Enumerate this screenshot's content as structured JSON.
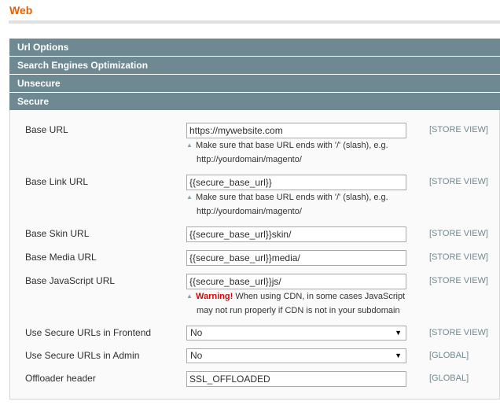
{
  "page": {
    "title": "Web"
  },
  "sections": [
    {
      "label": "Url Options"
    },
    {
      "label": "Search Engines Optimization"
    },
    {
      "label": "Unsecure"
    },
    {
      "label": "Secure"
    }
  ],
  "fields": {
    "base_url": {
      "label": "Base URL",
      "value": "https://mywebsite.com",
      "scope": "[STORE VIEW]",
      "note_line1": "Make sure that base URL ends with '/' (slash), e.g.",
      "note_line2": "http://yourdomain/magento/"
    },
    "base_link_url": {
      "label": "Base Link URL",
      "value": "{{secure_base_url}}",
      "scope": "[STORE VIEW]",
      "note_line1": "Make sure that base URL ends with '/' (slash), e.g.",
      "note_line2": "http://yourdomain/magento/"
    },
    "base_skin_url": {
      "label": "Base Skin URL",
      "value": "{{secure_base_url}}skin/",
      "scope": "[STORE VIEW]"
    },
    "base_media_url": {
      "label": "Base Media URL",
      "value": "{{secure_base_url}}media/",
      "scope": "[STORE VIEW]"
    },
    "base_js_url": {
      "label": "Base JavaScript URL",
      "value": "{{secure_base_url}}js/",
      "scope": "[STORE VIEW]",
      "warning_label": "Warning!",
      "note_line1": "When using CDN, in some cases JavaScript",
      "note_line2": "may not run properly if CDN is not in your subdomain"
    },
    "use_secure_frontend": {
      "label": "Use Secure URLs in Frontend",
      "value": "No",
      "scope": "[STORE VIEW]"
    },
    "use_secure_admin": {
      "label": "Use Secure URLs in Admin",
      "value": "No",
      "scope": "[GLOBAL]"
    },
    "offloader_header": {
      "label": "Offloader header",
      "value": "SSL_OFFLOADED",
      "scope": "[GLOBAL]"
    }
  },
  "icons": {
    "note": "triangle-up-icon",
    "dropdown": "arrow-down-icon"
  },
  "colors": {
    "title": "#eb5e00",
    "section_header": "#6f8992",
    "scope": "#6f8992",
    "warning": "#d40707"
  }
}
